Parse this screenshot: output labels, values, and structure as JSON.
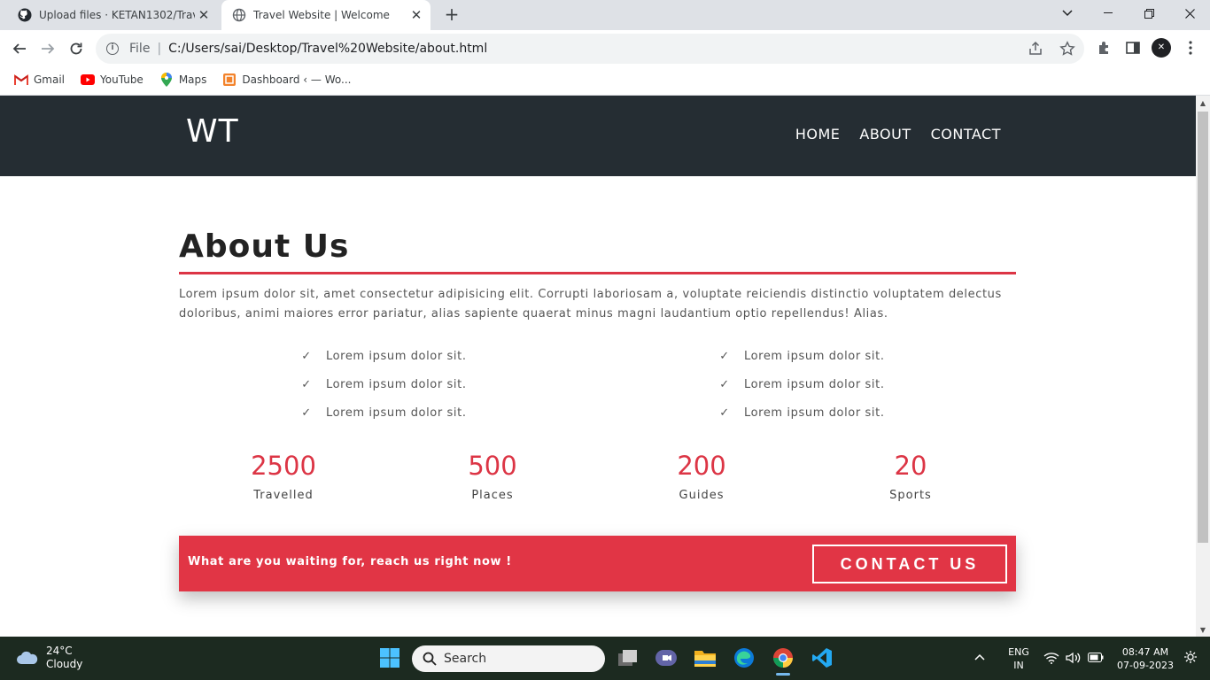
{
  "browser": {
    "tabs": [
      {
        "title": "Upload files · KETAN1302/Travel-",
        "active": false
      },
      {
        "title": "Travel Website | Welcome",
        "active": true
      }
    ],
    "address": {
      "scheme": "File",
      "url": "C:/Users/sai/Desktop/Travel%20Website/about.html"
    },
    "bookmarks": [
      {
        "label": "Gmail",
        "icon": "gmail-icon"
      },
      {
        "label": "YouTube",
        "icon": "youtube-icon"
      },
      {
        "label": "Maps",
        "icon": "maps-icon"
      },
      {
        "label": "Dashboard ‹ — Wo...",
        "icon": "dashboard-icon"
      }
    ]
  },
  "site": {
    "logo": "WT",
    "nav": [
      "HOME",
      "ABOUT",
      "CONTACT"
    ],
    "about": {
      "title": "About Us",
      "paragraph": "Lorem ipsum dolor sit, amet consectetur adipisicing elit. Corrupti laboriosam a, voluptate reiciendis distinctio voluptatem delectus doloribus, animi maiores error pariatur, alias sapiente quaerat minus magni laudantium optio repellendus! Alias.",
      "check_mark": "✓",
      "left_list": [
        "Lorem ipsum dolor sit.",
        "Lorem ipsum dolor sit.",
        "Lorem ipsum dolor sit."
      ],
      "right_list": [
        "Lorem ipsum dolor sit.",
        "Lorem ipsum dolor sit.",
        "Lorem ipsum dolor sit."
      ]
    },
    "stats": [
      {
        "value": "2500",
        "label": "Travelled"
      },
      {
        "value": "500",
        "label": "Places"
      },
      {
        "value": "200",
        "label": "Guides"
      },
      {
        "value": "20",
        "label": "Sports"
      }
    ],
    "cta": {
      "text": "What are you waiting for, reach us right now !",
      "button": "CONTACT US"
    },
    "colors": {
      "header_bg": "#252d33",
      "accent": "#dc3545",
      "cta_bg": "#e13545"
    }
  },
  "taskbar": {
    "weather": {
      "temp": "24°C",
      "condition": "Cloudy"
    },
    "search_placeholder": "Search",
    "language": {
      "line1": "ENG",
      "line2": "IN"
    },
    "clock": {
      "time": "08:47 AM",
      "date": "07-09-2023"
    }
  }
}
